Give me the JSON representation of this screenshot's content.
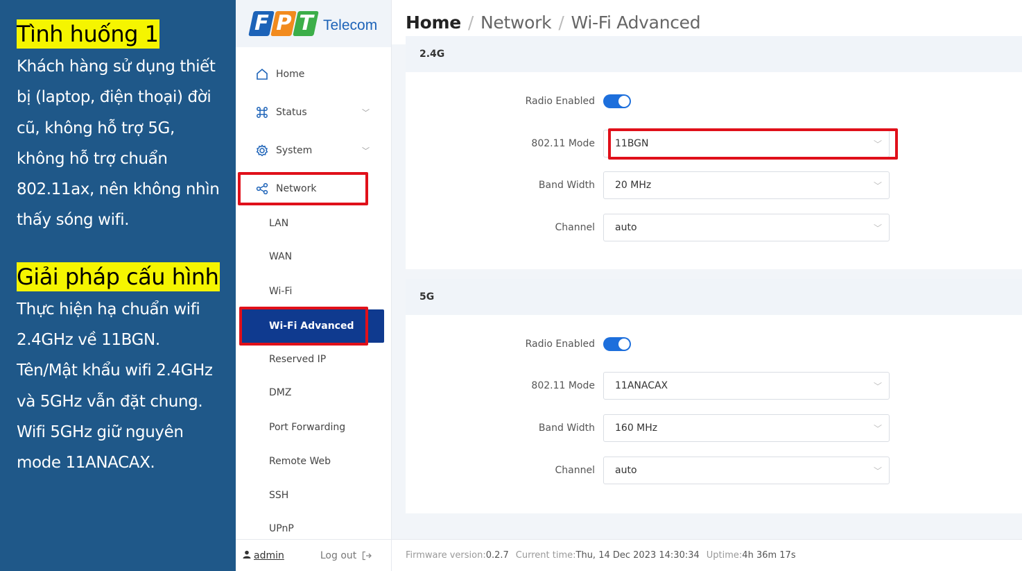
{
  "info": {
    "heading1": "Tình huống 1",
    "paragraph1": "Khách hàng sử dụng thiết bị (laptop, điện thoại) đời cũ, không hỗ trợ 5G, không hỗ trợ chuẩn 802.11ax, nên không nhìn thấy sóng wifi.",
    "heading2": "Giải pháp cấu hình",
    "paragraph2": "Thực hiện hạ chuẩn wifi 2.4GHz về 11BGN. Tên/Mật khẩu wifi 2.4GHz và 5GHz vẫn đặt chung. Wifi 5GHz giữ nguyên mode 11ANACAX."
  },
  "logo": {
    "letters": [
      "F",
      "P",
      "T"
    ],
    "telecom": "Telecom"
  },
  "sidebar": {
    "nav": [
      {
        "label": "Home",
        "icon": "home-icon"
      },
      {
        "label": "Status",
        "icon": "command-icon"
      },
      {
        "label": "System",
        "icon": "gear-icon"
      },
      {
        "label": "Network",
        "icon": "share-icon"
      }
    ],
    "sub": [
      "LAN",
      "WAN",
      "Wi-Fi",
      "Wi-Fi Advanced",
      "Reserved IP",
      "DMZ",
      "Port Forwarding",
      "Remote Web",
      "SSH",
      "UPnP"
    ],
    "active_sub": "Wi-Fi Advanced",
    "user": "admin",
    "logout": "Log out"
  },
  "breadcrumb": {
    "home": "Home",
    "sep": "/",
    "section": "Network",
    "page": "Wi-Fi Advanced"
  },
  "band24": {
    "title": "2.4G",
    "radio_label": "Radio Enabled",
    "radio_enabled": true,
    "mode_label": "802.11 Mode",
    "mode_value": "11BGN",
    "bw_label": "Band Width",
    "bw_value": "20 MHz",
    "channel_label": "Channel",
    "channel_value": "auto"
  },
  "band5": {
    "title": "5G",
    "radio_label": "Radio Enabled",
    "radio_enabled": true,
    "mode_label": "802.11 Mode",
    "mode_value": "11ANACAX",
    "bw_label": "Band Width",
    "bw_value": "160 MHz",
    "channel_label": "Channel",
    "channel_value": "auto"
  },
  "status": {
    "fw_label": "Firmware version:",
    "fw_value": "0.2.7",
    "time_label": "Current time:",
    "time_value": "Thu, 14 Dec 2023 14:30:34",
    "uptime_label": "Uptime:",
    "uptime_value": "4h 36m 17s"
  },
  "colors": {
    "panel_bg": "#1f5889",
    "highlight": "#f5f500",
    "accent": "#1d6fdc",
    "active_nav": "#0f3a8f",
    "annotation_red": "#e0101a",
    "logo_f": "#1d63b8",
    "logo_p": "#f28b1e",
    "logo_t": "#3cae49"
  }
}
